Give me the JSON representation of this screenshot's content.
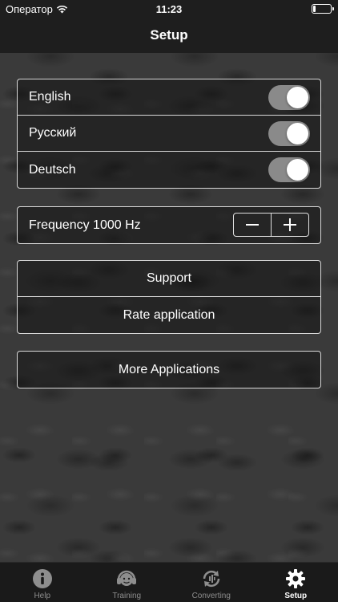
{
  "status_bar": {
    "carrier": "Оператор",
    "time": "11:23",
    "battery_level": 0.15
  },
  "nav": {
    "title": "Setup"
  },
  "languages": [
    {
      "label": "English",
      "enabled": true
    },
    {
      "label": "Русский",
      "enabled": true
    },
    {
      "label": "Deutsch",
      "enabled": true
    }
  ],
  "frequency": {
    "label": "Frequency 1000 Hz",
    "decrement": "−",
    "increment": "+"
  },
  "links": {
    "support": "Support",
    "rate": "Rate application"
  },
  "more": {
    "label": "More Applications"
  },
  "tabs": [
    {
      "label": "Help",
      "icon": "info-icon"
    },
    {
      "label": "Training",
      "icon": "headphones-icon"
    },
    {
      "label": "Converting",
      "icon": "refresh-icon"
    },
    {
      "label": "Setup",
      "icon": "gear-icon"
    }
  ],
  "colors": {
    "toggle_on": "#8a8a8a",
    "bar_bg": "#1e1e1e",
    "tab_active": "#ffffff",
    "tab_inactive": "#8e8e8e"
  }
}
